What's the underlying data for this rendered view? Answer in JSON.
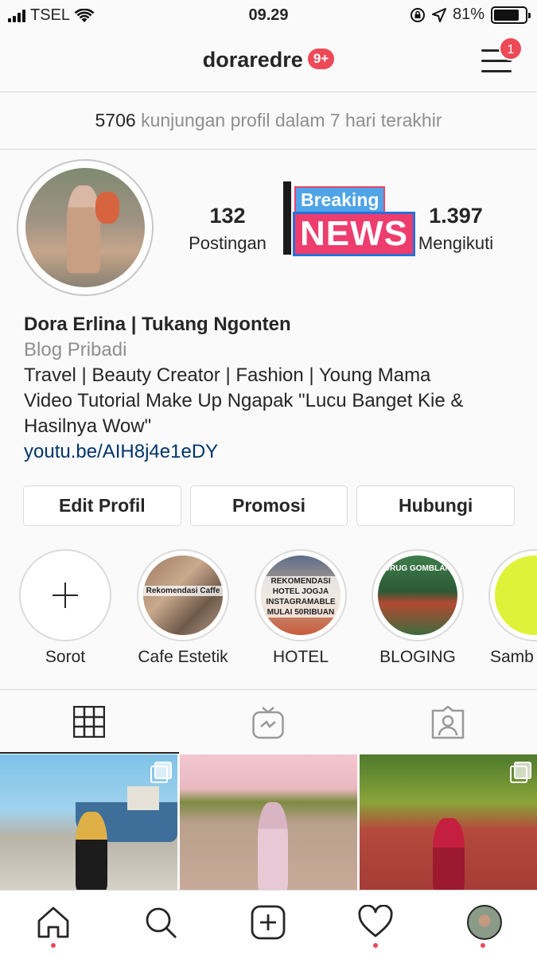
{
  "status_bar": {
    "carrier": "TSEL",
    "time": "09.29",
    "battery": "81%"
  },
  "header": {
    "username": "doraredre",
    "notification_badge": "9+",
    "menu_badge": "1"
  },
  "profile_visits": {
    "count": "5706",
    "text": "kunjungan profil dalam 7 hari terakhir"
  },
  "stats": {
    "posts": {
      "value": "132",
      "label": "Postingan"
    },
    "following": {
      "value": "1.397",
      "label": "Mengikuti"
    }
  },
  "overlay_sticker": {
    "line1": "Breaking",
    "line2": "NEWS"
  },
  "bio": {
    "name": "Dora Erlina | Tukang Ngonten",
    "category": "Blog Pribadi",
    "line1": "Travel | Beauty Creator | Fashion | Young Mama",
    "line2": "Video Tutorial Make Up Ngapak \"Lucu Banget Kie &",
    "line3": "Hasilnya Wow\"",
    "link": "youtu.be/AIH8j4e1eDY"
  },
  "buttons": {
    "edit": "Edit Profil",
    "promote": "Promosi",
    "contact": "Hubungi"
  },
  "highlights": [
    {
      "label": "Sorot"
    },
    {
      "label": "Cafe Estetik",
      "thumb_text": "Rekomendasi Caffe"
    },
    {
      "label": "HOTEL",
      "thumb_text": "REKOMENDASI HOTEL JOGJA INSTAGRAMABLE MULAI 50RIBUAN"
    },
    {
      "label": "BLOGING",
      "thumb_text": "CURUG GOMBLANG"
    },
    {
      "label": "Samb"
    }
  ],
  "tabs": [
    {
      "icon": "grid-icon",
      "active": true
    },
    {
      "icon": "igtv-icon",
      "active": false
    },
    {
      "icon": "tagged-icon",
      "active": false
    }
  ],
  "bottom_nav": [
    "home-icon",
    "search-icon",
    "new-post-icon",
    "activity-heart-icon",
    "profile-avatar"
  ]
}
